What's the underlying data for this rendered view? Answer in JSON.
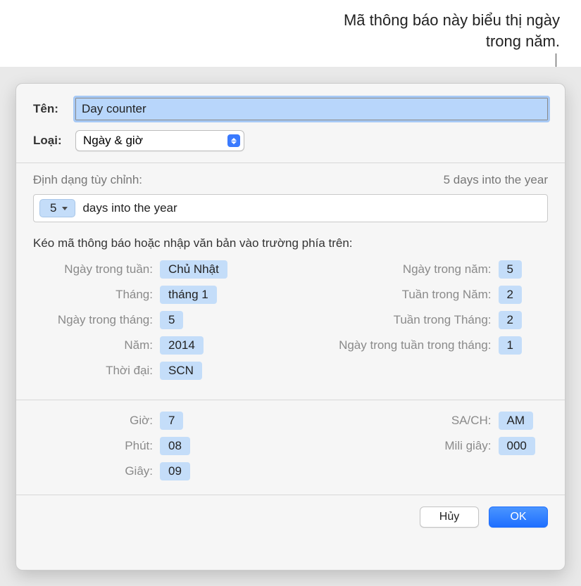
{
  "callout": "Mã thông báo này biểu thị ngày trong năm.",
  "labels": {
    "name": "Tên:",
    "type": "Loại:",
    "customFormat": "Định dạng tùy chỉnh:",
    "preview": "5 days into the year",
    "dragInstr": "Kéo mã thông báo hoặc nhập văn bản vào trường phía trên:"
  },
  "fields": {
    "name": "Day counter",
    "type": "Ngày & giờ"
  },
  "formatToken": "5",
  "formatText": "days into the year",
  "dateTokens": {
    "left": [
      {
        "label": "Ngày trong tuần:",
        "value": "Chủ Nhật"
      },
      {
        "label": "Tháng:",
        "value": "tháng 1"
      },
      {
        "label": "Ngày trong tháng:",
        "value": "5"
      },
      {
        "label": "Năm:",
        "value": "2014"
      },
      {
        "label": "Thời đại:",
        "value": "SCN"
      }
    ],
    "right": [
      {
        "label": "Ngày trong năm:",
        "value": "5"
      },
      {
        "label": "Tuần trong Năm:",
        "value": "2"
      },
      {
        "label": "Tuần trong Tháng:",
        "value": "2"
      },
      {
        "label": "Ngày trong tuần trong tháng:",
        "value": "1"
      }
    ]
  },
  "timeTokens": {
    "left": [
      {
        "label": "Giờ:",
        "value": "7"
      },
      {
        "label": "Phút:",
        "value": "08"
      },
      {
        "label": "Giây:",
        "value": "09"
      }
    ],
    "right": [
      {
        "label": "SA/CH:",
        "value": "AM"
      },
      {
        "label": "Mili giây:",
        "value": "000"
      }
    ]
  },
  "buttons": {
    "cancel": "Hủy",
    "ok": "OK"
  }
}
